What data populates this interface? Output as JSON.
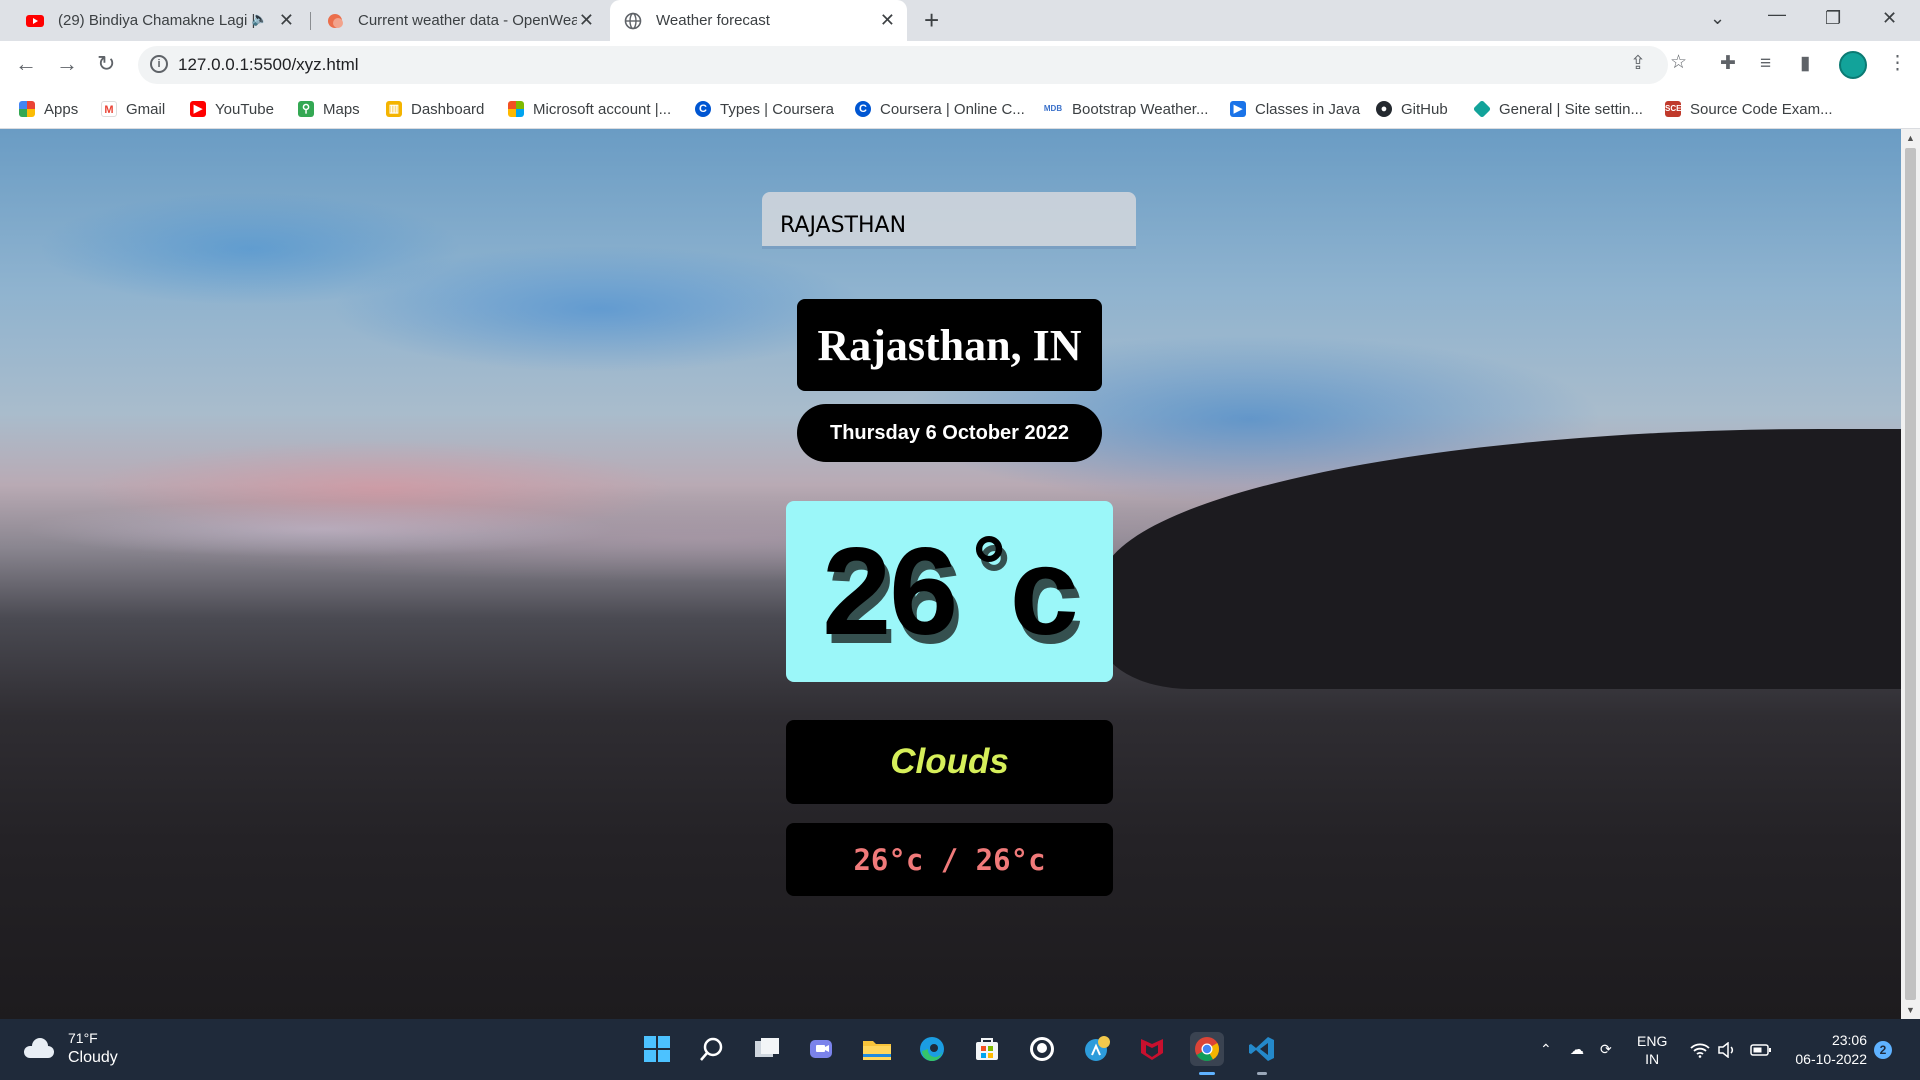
{
  "browser": {
    "tabs": [
      {
        "title": "(29) Bindiya Chamakne Lagi |",
        "favicon": "youtube-icon",
        "audio": true,
        "active": false
      },
      {
        "title": "Current weather data - OpenWea",
        "favicon": "openweather-icon",
        "active": false
      },
      {
        "title": "Weather forecast",
        "favicon": "globe-icon",
        "active": true
      }
    ],
    "url": "127.0.0.1:5500/xyz.html",
    "bookmarks": [
      {
        "label": "Apps",
        "icon": "apps-grid-icon"
      },
      {
        "label": "Gmail",
        "icon": "gmail-icon"
      },
      {
        "label": "YouTube",
        "icon": "youtube-icon"
      },
      {
        "label": "Maps",
        "icon": "maps-icon"
      },
      {
        "label": "Dashboard",
        "icon": "dashboard-icon"
      },
      {
        "label": "Microsoft account |...",
        "icon": "microsoft-icon"
      },
      {
        "label": "Types | Coursera",
        "icon": "coursera-icon"
      },
      {
        "label": "Coursera | Online C...",
        "icon": "coursera-icon"
      },
      {
        "label": "Bootstrap Weather...",
        "icon": "mdb-icon"
      },
      {
        "label": "Classes in Java",
        "icon": "video-icon"
      },
      {
        "label": "GitHub",
        "icon": "github-icon"
      },
      {
        "label": "General | Site settin...",
        "icon": "site-settings-icon"
      },
      {
        "label": "Source Code Exam...",
        "icon": "source-code-icon"
      }
    ]
  },
  "app": {
    "search_value": "RAJASTHAN",
    "location": "Rajasthan, IN",
    "date": "Thursday 6 October 2022",
    "temperature": {
      "value": "26",
      "degree": "°",
      "unit": "c"
    },
    "condition": "Clouds",
    "min_max": "26°c / 26°c",
    "colors": {
      "temp_bg": "#9bf7f9",
      "condition_text": "#d6ef5a",
      "range_text": "#f07a7a"
    }
  },
  "taskbar": {
    "weather_temp": "71°F",
    "weather_desc": "Cloudy",
    "language": "ENG",
    "region": "IN",
    "time": "23:06",
    "date": "06-10-2022",
    "notifications": "2"
  }
}
